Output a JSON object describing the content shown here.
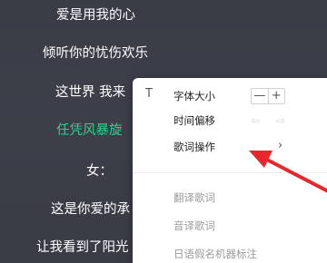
{
  "lyrics": [
    "爱是用我的心",
    "倾听你的忧伤欢乐",
    "这世界 我来",
    "任凭风暴旋",
    "女：",
    "这是你爱的承",
    "让我看到了阳光"
  ],
  "menu": {
    "font_size_label": "字体大小",
    "font_icon": "T",
    "minus": "—",
    "plus": "+",
    "time_offset_label": "时间偏移",
    "shift_left": "⇦",
    "shift_right": "⇨",
    "lyric_ops_label": "歌词操作",
    "chevron": "›",
    "translate_label": "翻译歌词",
    "transliterate_label": "音译歌词",
    "kana_label": "日语假名机器标注"
  },
  "colors": {
    "active_lyric": "#2fcf8d",
    "arrow": "#e8262c"
  }
}
